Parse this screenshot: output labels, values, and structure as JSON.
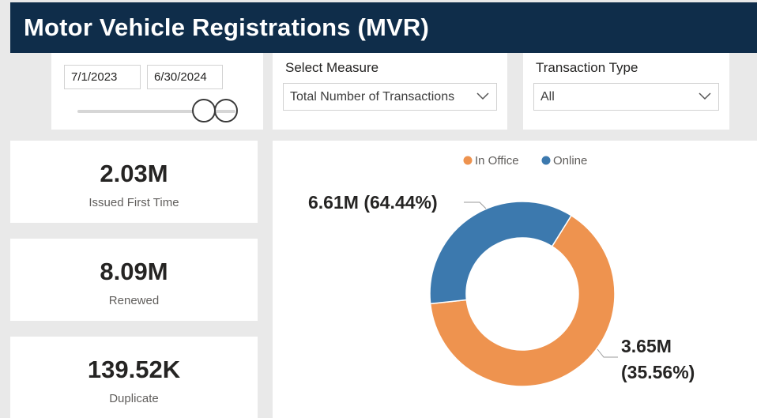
{
  "header": {
    "title": "Motor Vehicle Registrations (MVR)"
  },
  "date_slicer": {
    "start_date": "7/1/2023",
    "end_date": "6/30/2024"
  },
  "measure_slicer": {
    "label": "Select Measure",
    "selected": "Total Number of Transactions"
  },
  "type_slicer": {
    "label": "Transaction Type",
    "selected": "All"
  },
  "kpis": [
    {
      "value": "2.03M",
      "label": "Issued First Time"
    },
    {
      "value": "8.09M",
      "label": "Renewed"
    },
    {
      "value": "139.52K",
      "label": "Duplicate"
    }
  ],
  "chart_data": {
    "type": "pie",
    "donut": true,
    "categories": [
      "In Office",
      "Online"
    ],
    "values": [
      6.61,
      3.65
    ],
    "percentages": [
      64.44,
      35.56
    ],
    "data_labels": [
      "6.61M (64.44%)",
      "3.65M (35.56%)"
    ],
    "colors": [
      "#ee934f",
      "#3c79ae"
    ],
    "legend_position": "top-center"
  },
  "colors": {
    "header_bg": "#0f2d4a",
    "in_office": "#ee934f",
    "online": "#3c79ae",
    "page_bg": "#e9e9e9"
  }
}
